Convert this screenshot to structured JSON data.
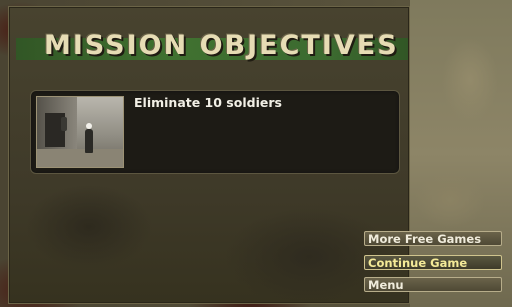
{
  "screen": {
    "title": "MISSION OBJECTIVES",
    "objectives": [
      {
        "text": "Eliminate 10 soldiers",
        "thumbnail": "soldiers-scene-image"
      }
    ]
  },
  "menu": {
    "more_free_games": "More Free Games",
    "continue_game": "Continue Game",
    "menu": "Menu"
  },
  "colors": {
    "title_text": "#e6dcb4",
    "title_bar": "#3f7a30",
    "active_button_text": "#f4ea98",
    "button_text": "#f0ecdc"
  }
}
